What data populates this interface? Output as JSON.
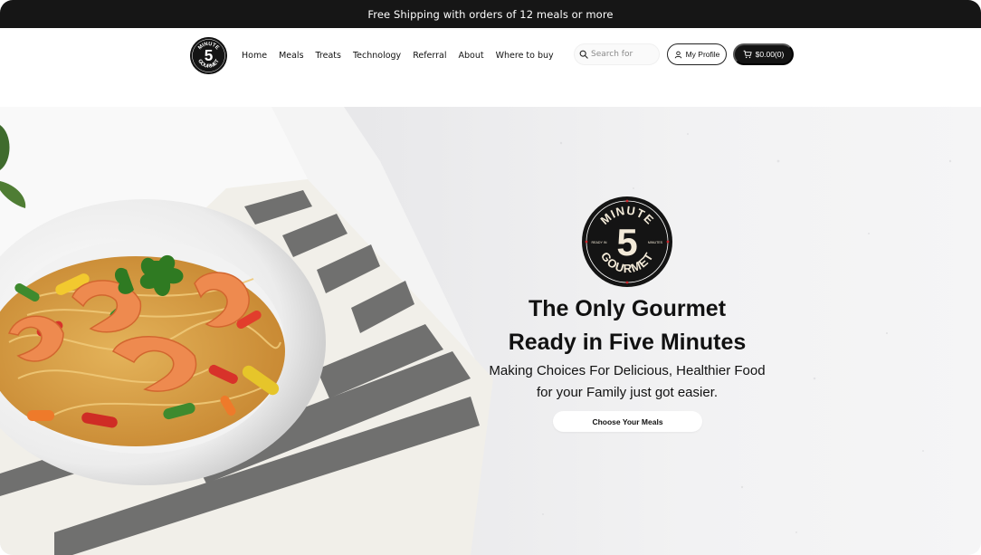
{
  "announcement": {
    "text": "Free Shipping with orders of 12 meals or more"
  },
  "header": {
    "logo_lines": {
      "top": "MINUTE",
      "number": "5",
      "bottom": "GOURMET"
    },
    "nav": [
      "Home",
      "Meals",
      "Treats",
      "Technology",
      "Referral",
      "About",
      "Where to buy"
    ],
    "search": {
      "placeholder": "Search for",
      "value": ""
    },
    "profile_label": "My Profile",
    "cart_label": "$0.00(0)"
  },
  "hero": {
    "logo": {
      "top": "MINUTE",
      "number": "5",
      "bottom": "GOURMET",
      "left_small": "READY IN",
      "right_small": "MINUTES"
    },
    "title_line1": "The Only Gourmet",
    "title_line2": "Ready in Five Minutes",
    "subtitle_line1": "Making Choices For Delicious, Healthier Food",
    "subtitle_line2": "for your Family just got easier.",
    "cta_label": "Choose Your Meals"
  },
  "colors": {
    "bar": "#161616",
    "accent_red": "#d0262c",
    "dark_button": "#141414"
  }
}
